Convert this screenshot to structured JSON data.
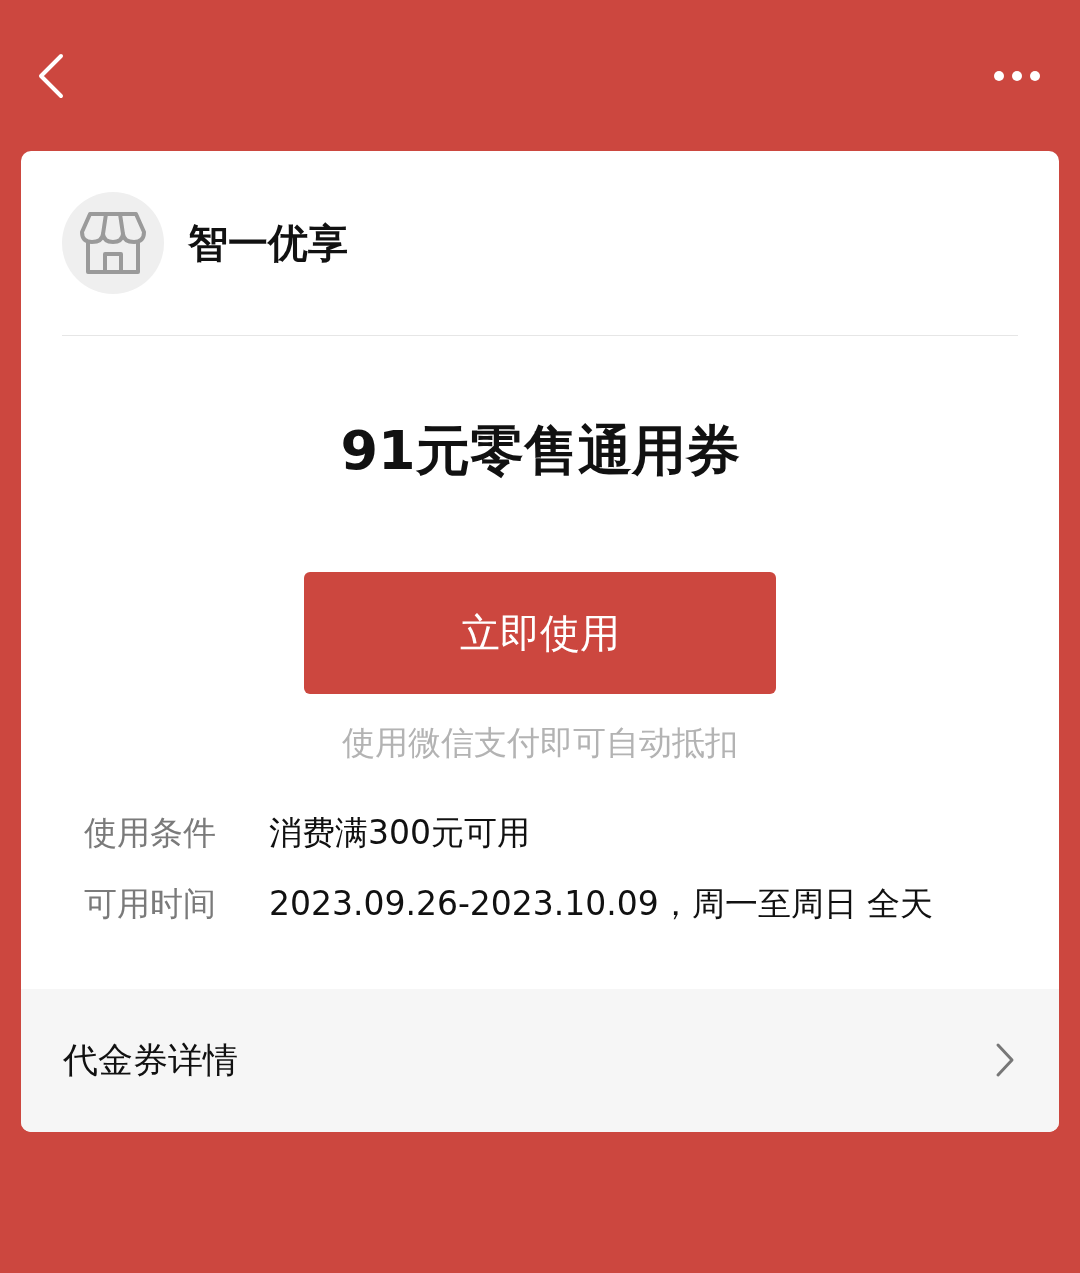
{
  "store": {
    "name": "智一优享"
  },
  "coupon": {
    "title": "91元零售通用券",
    "button": "立即使用",
    "hint": "使用微信支付即可自动抵扣"
  },
  "details": [
    {
      "label": "使用条件",
      "value": "消费满300元可用"
    },
    {
      "label": "可用时间",
      "value": "2023.09.26-2023.10.09，周一至周日 全天"
    }
  ],
  "footer": {
    "link": "代金券详情"
  }
}
